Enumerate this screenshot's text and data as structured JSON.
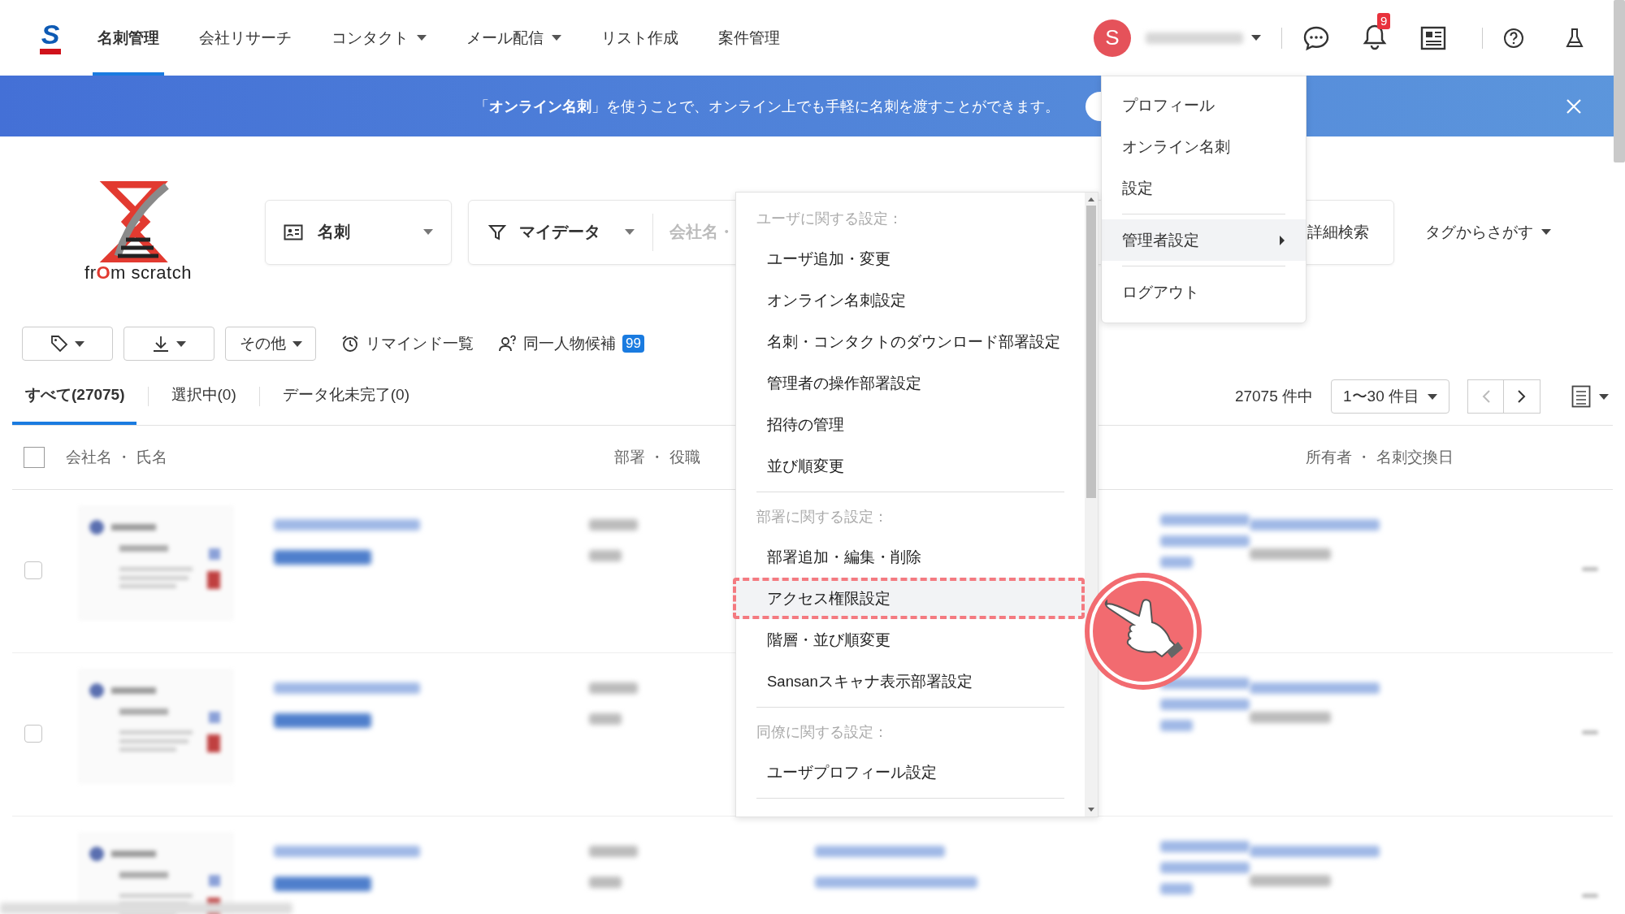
{
  "header": {
    "app_logo": "S",
    "nav": [
      {
        "label": "名刺管理",
        "selected": true,
        "dropdown": false
      },
      {
        "label": "会社リサーチ",
        "selected": false,
        "dropdown": false
      },
      {
        "label": "コンタクト",
        "selected": false,
        "dropdown": true
      },
      {
        "label": "メール配信",
        "selected": false,
        "dropdown": true
      },
      {
        "label": "リスト作成",
        "selected": false,
        "dropdown": false
      },
      {
        "label": "案件管理",
        "selected": false,
        "dropdown": false
      }
    ],
    "avatar": "S",
    "notification_count": "9"
  },
  "banner": {
    "text": "「**オンライン名刺**」を使うことで、オンライン上でも手軽に名刺を渡すことができます。"
  },
  "company_logo": {
    "parts": [
      {
        "text": "fr",
        "accent": false
      },
      {
        "text": "O",
        "accent": true
      },
      {
        "text": "m scratch",
        "accent": false
      }
    ]
  },
  "search": {
    "type_select": "名刺",
    "data_filter": "マイデータ",
    "keyword_placeholder": "会社名・",
    "advanced": "詳細検索",
    "tag_search": "タグからさがす"
  },
  "toolbar": {
    "other": "その他",
    "remind": "リマインド一覧",
    "duplicates": "同一人物候補",
    "duplicates_count": "99"
  },
  "tabs": [
    {
      "label": "すべて(27075)",
      "selected": true
    },
    {
      "label": "選択中(0)",
      "selected": false
    },
    {
      "label": "データ化未完了(0)",
      "selected": false
    }
  ],
  "pagination": {
    "total": "27075 件中",
    "range": "1〜30 件目"
  },
  "table": {
    "select_all_checked": false,
    "columns": [
      "会社名 ・ 氏名",
      "部署 ・ 役職",
      "所有者 ・ 名刺交換日"
    ],
    "rows": [
      {
        "kind": "blurred",
        "checked": false
      },
      {
        "kind": "blurred",
        "checked": false
      },
      {
        "kind": "blurred_contact"
      }
    ]
  },
  "profile_menu": {
    "items": [
      {
        "label": "プロフィール",
        "kind": "item",
        "highlighted": false
      },
      {
        "label": "オンライン名刺",
        "kind": "item",
        "highlighted": false
      },
      {
        "label": "設定",
        "kind": "item",
        "highlighted": false
      },
      {
        "label": "管理者設定",
        "kind": "submenu",
        "highlighted": true
      },
      {
        "label": "ログアウト",
        "kind": "item",
        "highlighted": false
      }
    ]
  },
  "settings_menu": {
    "sections": [
      {
        "heading": "ユーザに関する設定：",
        "items": [
          {
            "label": "ユーザ追加・変更",
            "highlighted": false
          },
          {
            "label": "オンライン名刺設定",
            "highlighted": false
          },
          {
            "label": "名刺・コンタクトのダウンロード部署設定",
            "highlighted": false
          },
          {
            "label": "管理者の操作部署設定",
            "highlighted": false
          },
          {
            "label": "招待の管理",
            "highlighted": false
          },
          {
            "label": "並び順変更",
            "highlighted": false
          }
        ]
      },
      {
        "heading": "部署に関する設定：",
        "items": [
          {
            "label": "部署追加・編集・削除",
            "highlighted": false
          },
          {
            "label": "アクセス権限設定",
            "highlighted": true
          },
          {
            "label": "階層・並び順変更",
            "highlighted": false
          },
          {
            "label": "Sansanスキャナ表示部署設定",
            "highlighted": false
          }
        ]
      },
      {
        "heading": "同僚に関する設定：",
        "items": [
          {
            "label": "ユーザプロフィール設定",
            "highlighted": false
          }
        ]
      }
    ]
  }
}
